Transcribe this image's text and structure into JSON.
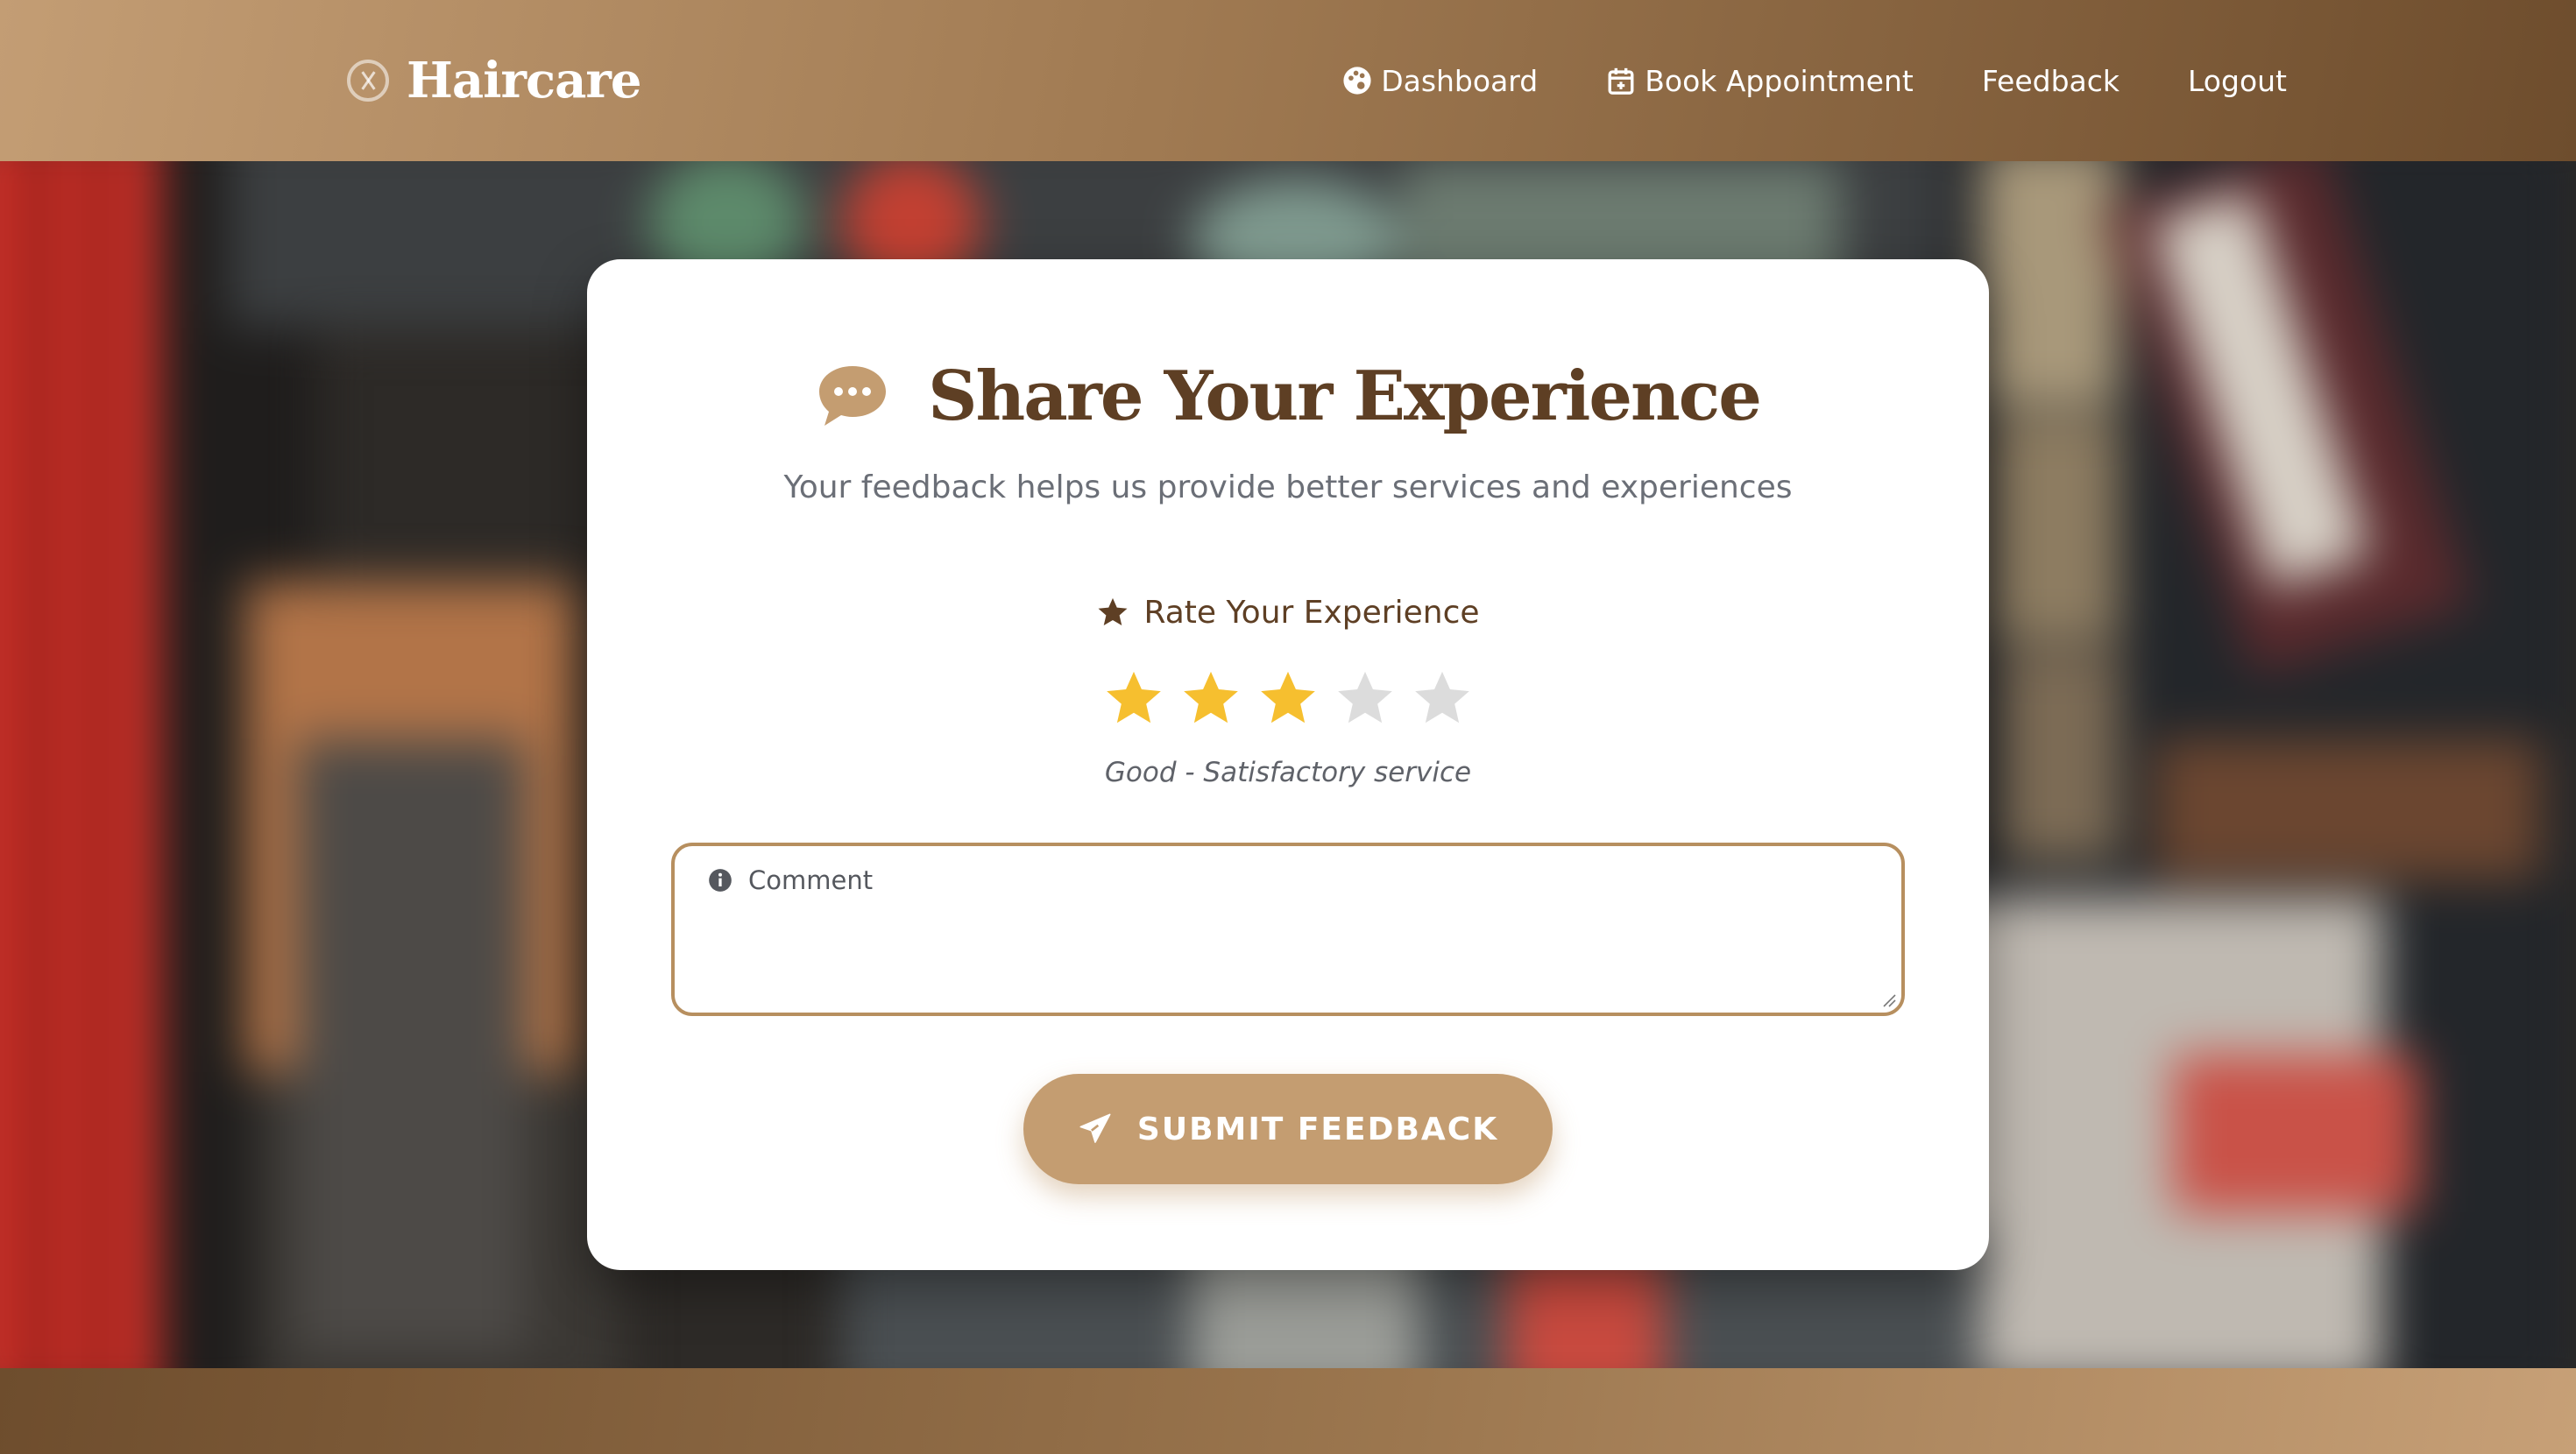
{
  "brand": {
    "name": "Haircare",
    "icon": "scissors-circle-icon"
  },
  "nav": {
    "items": [
      {
        "label": "Dashboard",
        "icon": "palette-icon"
      },
      {
        "label": "Book Appointment",
        "icon": "calendar-plus-icon"
      },
      {
        "label": "Feedback"
      },
      {
        "label": "Logout"
      }
    ]
  },
  "feedback": {
    "title": "Share Your Experience",
    "subtitle": "Your feedback helps us provide better services and experiences",
    "rating_label": "Rate Your Experience",
    "rating": {
      "value": 3,
      "max": 5
    },
    "rating_text": "Good - Satisfactory service",
    "comment": {
      "label": "Comment",
      "value": ""
    },
    "submit_label": "SUBMIT FEEDBACK"
  },
  "colors": {
    "brand_brown": "#5e3f24",
    "accent_tan": "#c49d71",
    "star_filled": "#f6bf2f",
    "star_empty": "#dcdcdc"
  }
}
